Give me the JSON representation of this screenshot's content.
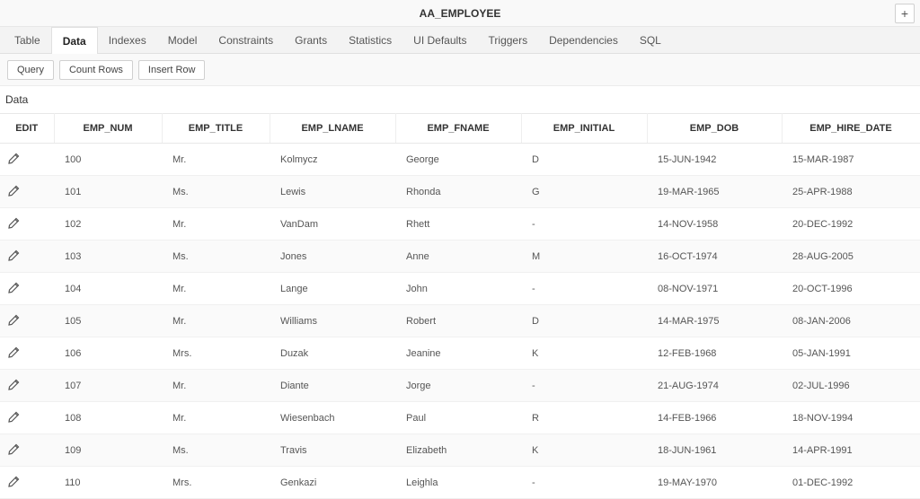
{
  "header": {
    "title": "AA_EMPLOYEE",
    "add_label": "+"
  },
  "tabs": [
    {
      "label": "Table",
      "active": false
    },
    {
      "label": "Data",
      "active": true
    },
    {
      "label": "Indexes",
      "active": false
    },
    {
      "label": "Model",
      "active": false
    },
    {
      "label": "Constraints",
      "active": false
    },
    {
      "label": "Grants",
      "active": false
    },
    {
      "label": "Statistics",
      "active": false
    },
    {
      "label": "UI Defaults",
      "active": false
    },
    {
      "label": "Triggers",
      "active": false
    },
    {
      "label": "Dependencies",
      "active": false
    },
    {
      "label": "SQL",
      "active": false
    }
  ],
  "toolbar": {
    "query": "Query",
    "count_rows": "Count Rows",
    "insert_row": "Insert Row"
  },
  "section_label": "Data",
  "columns": {
    "edit": "EDIT",
    "emp_num": "EMP_NUM",
    "emp_title": "EMP_TITLE",
    "emp_lname": "EMP_LNAME",
    "emp_fname": "EMP_FNAME",
    "emp_initial": "EMP_INITIAL",
    "emp_dob": "EMP_DOB",
    "emp_hire_date": "EMP_HIRE_DATE"
  },
  "rows": [
    {
      "num": "100",
      "title": "Mr.",
      "lname": "Kolmycz",
      "fname": "George",
      "initial": "D",
      "dob": "15-JUN-1942",
      "hire": "15-MAR-1987"
    },
    {
      "num": "101",
      "title": "Ms.",
      "lname": "Lewis",
      "fname": "Rhonda",
      "initial": "G",
      "dob": "19-MAR-1965",
      "hire": "25-APR-1988"
    },
    {
      "num": "102",
      "title": "Mr.",
      "lname": "VanDam",
      "fname": "Rhett",
      "initial": "-",
      "dob": "14-NOV-1958",
      "hire": "20-DEC-1992"
    },
    {
      "num": "103",
      "title": "Ms.",
      "lname": "Jones",
      "fname": "Anne",
      "initial": "M",
      "dob": "16-OCT-1974",
      "hire": "28-AUG-2005"
    },
    {
      "num": "104",
      "title": "Mr.",
      "lname": "Lange",
      "fname": "John",
      "initial": "-",
      "dob": "08-NOV-1971",
      "hire": "20-OCT-1996"
    },
    {
      "num": "105",
      "title": "Mr.",
      "lname": "Williams",
      "fname": "Robert",
      "initial": "D",
      "dob": "14-MAR-1975",
      "hire": "08-JAN-2006"
    },
    {
      "num": "106",
      "title": "Mrs.",
      "lname": "Duzak",
      "fname": "Jeanine",
      "initial": "K",
      "dob": "12-FEB-1968",
      "hire": "05-JAN-1991"
    },
    {
      "num": "107",
      "title": "Mr.",
      "lname": "Diante",
      "fname": "Jorge",
      "initial": "-",
      "dob": "21-AUG-1974",
      "hire": "02-JUL-1996"
    },
    {
      "num": "108",
      "title": "Mr.",
      "lname": "Wiesenbach",
      "fname": "Paul",
      "initial": "R",
      "dob": "14-FEB-1966",
      "hire": "18-NOV-1994"
    },
    {
      "num": "109",
      "title": "Ms.",
      "lname": "Travis",
      "fname": "Elizabeth",
      "initial": "K",
      "dob": "18-JUN-1961",
      "hire": "14-APR-1991"
    },
    {
      "num": "110",
      "title": "Mrs.",
      "lname": "Genkazi",
      "fname": "Leighla",
      "initial": "-",
      "dob": "19-MAY-1970",
      "hire": "01-DEC-1992"
    }
  ]
}
